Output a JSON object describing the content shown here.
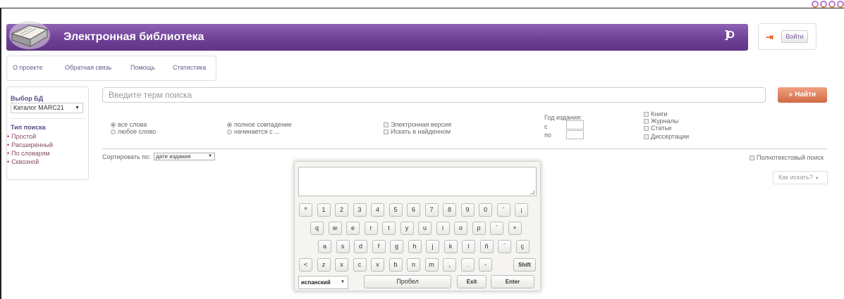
{
  "header": {
    "title": "Электронная библиотека",
    "logo_mark": "]D",
    "login_label": "Войти"
  },
  "nav": [
    "О проекте",
    "Обратная связь",
    "Помощь",
    "Статистика"
  ],
  "sidebar": {
    "db_heading": "Выбор БД",
    "db_value": "Каталог MARC21",
    "search_type_heading": "Тип поиска",
    "search_types": [
      "Простой",
      "Расширенный",
      "По словарям",
      "Сквозной"
    ]
  },
  "search": {
    "placeholder": "Введите терм поиска",
    "button": "Найти"
  },
  "options": {
    "words": [
      "все слова",
      "любое слово"
    ],
    "match": [
      "полное совпадение",
      "начинается с ..."
    ],
    "extra": [
      "Электронная версия",
      "Искать в найденном"
    ],
    "year_label": "Год издания:",
    "year_from": "с",
    "year_to": "по",
    "doc_types": [
      "Книги",
      "Журналы",
      "Статьи",
      "Диссертации"
    ]
  },
  "sort": {
    "label": "Сортировать по:",
    "value": "дате издания"
  },
  "fulltext_label": "Полнотекстовый поиск",
  "howto_label": "Как искать?",
  "keyboard": {
    "row1": [
      "º",
      "1",
      "2",
      "3",
      "4",
      "5",
      "6",
      "7",
      "8",
      "9",
      "0",
      "'",
      "¡"
    ],
    "row2": [
      "q",
      "w",
      "e",
      "r",
      "t",
      "y",
      "u",
      "i",
      "o",
      "p",
      "`",
      "+"
    ],
    "row3": [
      "a",
      "s",
      "d",
      "f",
      "g",
      "h",
      "j",
      "k",
      "l",
      "ñ",
      "´",
      "ç"
    ],
    "row4": [
      "<",
      "z",
      "x",
      "c",
      "v",
      "b",
      "n",
      "m",
      ",",
      ".",
      "-"
    ],
    "shift": "Shift",
    "language": "испанский",
    "space": "Пробел",
    "exit": "Exit",
    "enter": "Enter"
  },
  "colors": {
    "header": "#6d3f95",
    "search_button": "#d06a45",
    "link": "#8a4a6a"
  }
}
